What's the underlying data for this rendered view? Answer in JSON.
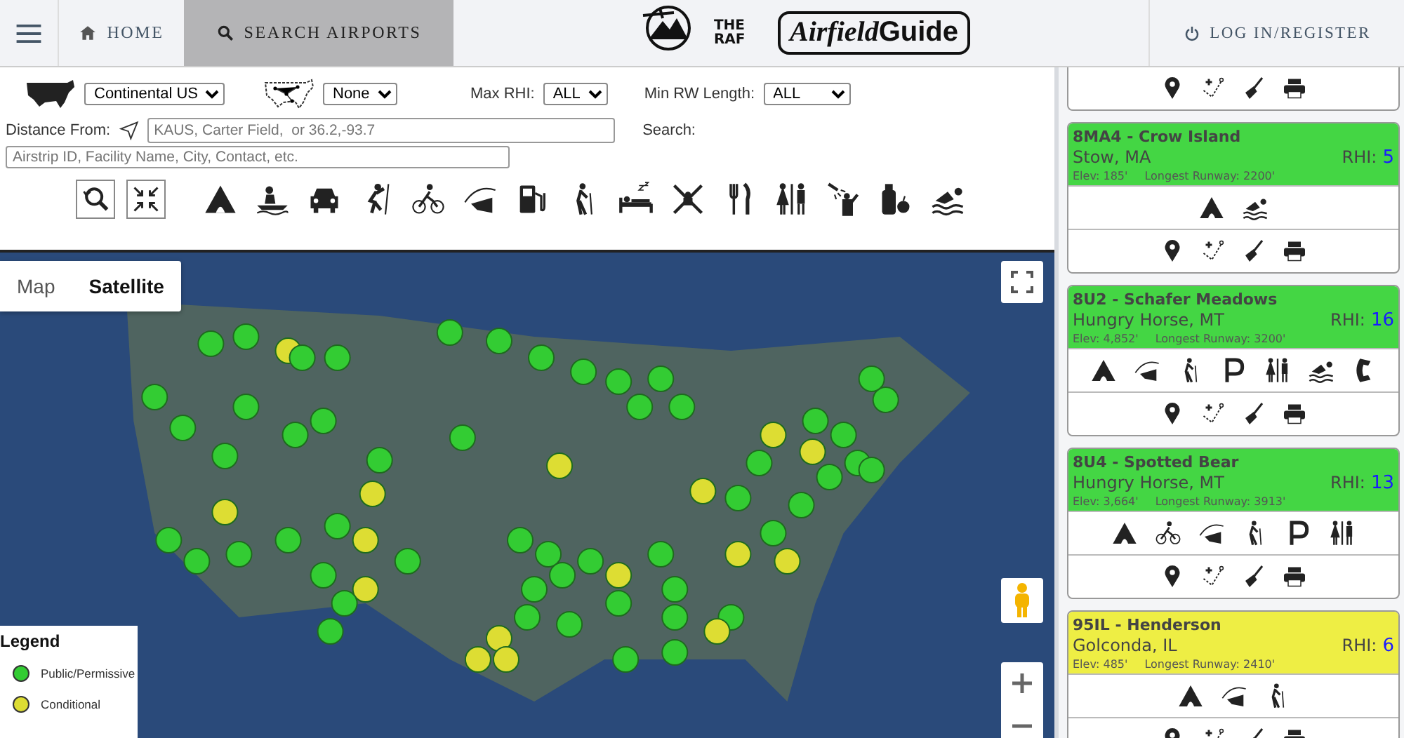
{
  "nav": {
    "items": [
      {
        "label": "HOME",
        "selected": false
      },
      {
        "label": "SEARCH AIRPORTS",
        "selected": true
      }
    ],
    "login": "LOG IN/REGISTER"
  },
  "logo": {
    "badge": "THE RAF",
    "name": "Airfield",
    "suffix": "Guide"
  },
  "filters": {
    "region": "Continental US",
    "network": "None",
    "max_rhi_label": "Max RHI:",
    "max_rhi": "ALL",
    "min_rw_label": "Min RW Length:",
    "min_rw": "ALL",
    "distance_label": "Distance From:",
    "distance_placeholder": "KAUS, Carter Field,  or 36.2,-93.7",
    "search_label": "Search:",
    "search_placeholder": "Airstrip ID, Facility Name, City, Contact, etc.",
    "amenities": [
      {
        "kind": "tent"
      },
      {
        "kind": "canoe"
      },
      {
        "kind": "car"
      },
      {
        "kind": "climbing"
      },
      {
        "kind": "bike"
      },
      {
        "kind": "fishing"
      },
      {
        "kind": "fuel"
      },
      {
        "kind": "hiking"
      },
      {
        "kind": "lodging"
      },
      {
        "kind": "kayak"
      },
      {
        "kind": "dining"
      },
      {
        "kind": "restroom"
      },
      {
        "kind": "shower"
      },
      {
        "kind": "store"
      },
      {
        "kind": "swim"
      }
    ]
  },
  "map": {
    "types": [
      {
        "label": "Map",
        "selected": false
      },
      {
        "label": "Satellite",
        "selected": true
      }
    ],
    "legend": {
      "title": "Legend",
      "items": [
        {
          "label": "Public/Permissive",
          "color": "#33cc33"
        },
        {
          "label": "Conditional",
          "color": "#dddd33"
        }
      ]
    }
  },
  "results": [
    {
      "title": "8MA4 - Crow Island",
      "city": "Stow, MA",
      "rhi_label": "RHI:",
      "rhi": "5",
      "elev": "Elev: 185'",
      "runway": "Longest Runway: 2200'",
      "color": "#44d644",
      "amenities": [
        {
          "kind": "tent"
        },
        {
          "kind": "swim"
        }
      ]
    },
    {
      "title": "8U2 - Schafer Meadows",
      "city": "Hungry Horse, MT",
      "rhi_label": "RHI:",
      "rhi": "16",
      "elev": "Elev: 4,852'",
      "runway": "Longest Runway: 3200'",
      "color": "#44d644",
      "amenities": [
        {
          "kind": "tent"
        },
        {
          "kind": "fishing"
        },
        {
          "kind": "hiking"
        },
        {
          "kind": "parking"
        },
        {
          "kind": "restroom"
        },
        {
          "kind": "swim"
        },
        {
          "kind": "phone"
        }
      ]
    },
    {
      "title": "8U4 - Spotted Bear",
      "city": "Hungry Horse, MT",
      "rhi_label": "RHI:",
      "rhi": "13",
      "elev": "Elev: 3,664'",
      "runway": "Longest Runway: 3913'",
      "color": "#44d644",
      "amenities": [
        {
          "kind": "tent"
        },
        {
          "kind": "bike"
        },
        {
          "kind": "fishing"
        },
        {
          "kind": "hiking"
        },
        {
          "kind": "parking"
        },
        {
          "kind": "restroom"
        }
      ]
    },
    {
      "title": "95IL - Henderson",
      "city": "Golconda, IL",
      "rhi_label": "RHI:",
      "rhi": "6",
      "elev": "Elev: 485'",
      "runway": "Longest Runway: 2410'",
      "color": "#eeee44",
      "amenities": [
        {
          "kind": "tent"
        },
        {
          "kind": "fishing"
        },
        {
          "kind": "hiking"
        }
      ]
    }
  ]
}
